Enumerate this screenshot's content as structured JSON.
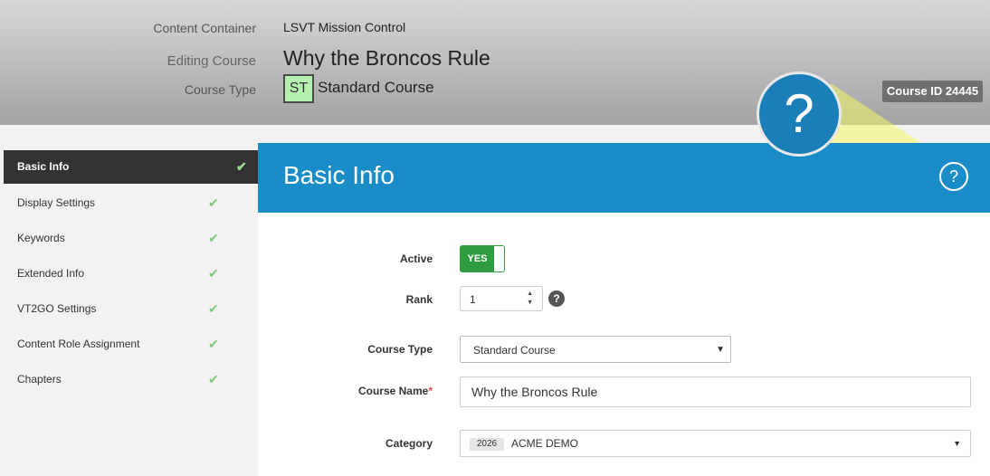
{
  "header": {
    "content_container_label": "Content Container",
    "content_container_value": "LSVT Mission Control",
    "editing_course_label": "Editing Course",
    "editing_course_value": "Why the Broncos Rule",
    "course_type_label": "Course Type",
    "course_type_badge": "ST",
    "course_type_value": "Standard Course",
    "course_id": "Course ID 24445"
  },
  "help": {
    "big_icon": "?",
    "small_icon": "?"
  },
  "sidebar": {
    "items": [
      {
        "label": "Basic Info",
        "active": true,
        "check": "✔"
      },
      {
        "label": "Display Settings",
        "check": "✔"
      },
      {
        "label": "Keywords",
        "check": "✔"
      },
      {
        "label": "Extended Info",
        "check": "✔"
      },
      {
        "label": "VT2GO Settings",
        "check": "✔"
      },
      {
        "label": "Content Role Assignment",
        "check": "✔"
      },
      {
        "label": "Chapters",
        "check": "✔"
      }
    ]
  },
  "panel": {
    "title": "Basic Info"
  },
  "form": {
    "active_label": "Active",
    "active_value": "YES",
    "rank_label": "Rank",
    "rank_value": "1",
    "rank_help": "?",
    "course_type_label": "Course Type",
    "course_type_value": "Standard Course",
    "course_name_label": "Course Name",
    "course_name_required": "*",
    "course_name_value": "Why the Broncos Rule",
    "category_label": "Category",
    "category_code": "2026",
    "category_value": "ACME DEMO"
  },
  "colors": {
    "panel_header": "#1a8dc9",
    "active_sidebar": "#333333",
    "toggle_green": "#2e9c3f",
    "badge_green": "#b6f0b1",
    "check_green": "#7ec87a",
    "spotlight_yellow": "#f5f56a"
  },
  "icons": {
    "check": "check-icon",
    "help": "question-circle-icon",
    "dropdown": "caret-down-icon",
    "spinner": "spinner-arrows-icon"
  }
}
